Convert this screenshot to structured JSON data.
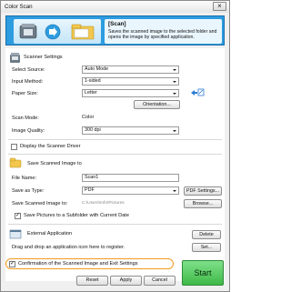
{
  "window": {
    "title": "Color Scan",
    "close_glyph": "×"
  },
  "banner": {
    "title": "[Scan]",
    "description": "Saves the scanned image to the selected folder and opens the image by specified application."
  },
  "scanner": {
    "header": "Scanner Settings",
    "select_source_label": "Select Source:",
    "select_source_value": "Auto Mode",
    "input_method_label": "Input Method:",
    "input_method_value": "1-sided",
    "paper_size_label": "Paper Size:",
    "paper_size_value": "Letter",
    "orientation_button": "Orientation...",
    "scan_mode_label": "Scan Mode:",
    "scan_mode_value": "Color",
    "image_quality_label": "Image Quality:",
    "image_quality_value": "300 dpi"
  },
  "display_driver": {
    "label": "Display the Scanner Driver",
    "checked": false
  },
  "save": {
    "header": "Save Scanned Image to",
    "file_name_label": "File Name:",
    "file_name_value": "Scan1",
    "save_type_label": "Save as Type:",
    "save_type_value": "PDF",
    "pdf_settings_button": "PDF Settings...",
    "save_to_label": "Save Scanned Image to:",
    "save_to_value": "C:\\Users\\Info\\Pictures",
    "browse_button": "Browse...",
    "subfolder_label": "Save Pictures to a Subfolder with Current Date",
    "subfolder_checked": true
  },
  "external": {
    "header": "External Application",
    "delete_button": "Delete",
    "drag_text": "Drag and drop an application icon here to register.",
    "set_button": "Set..."
  },
  "confirmation": {
    "label": "Confirmation of the Scanned Image and Exit Settings",
    "checked": true
  },
  "buttons": {
    "reset": "Reset",
    "apply": "Apply",
    "cancel": "Cancel",
    "start": "Start"
  },
  "colors": {
    "accent": "#2d9ce0",
    "start_green": "#44c14c",
    "highlight_orange": "#f29a1e"
  }
}
